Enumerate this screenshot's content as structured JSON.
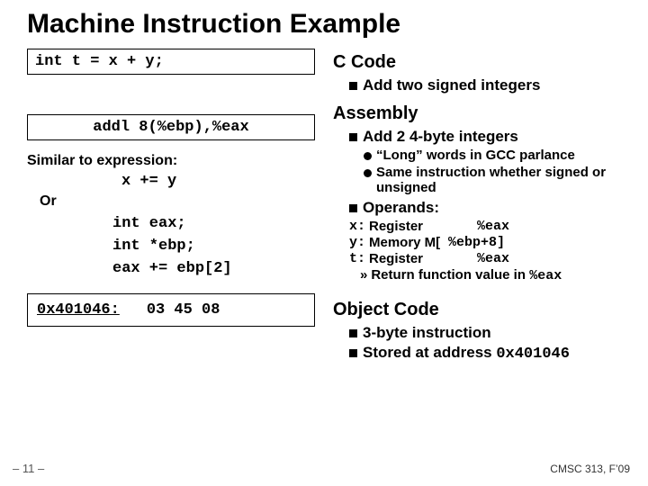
{
  "title": "Machine Instruction Example",
  "left": {
    "ccode": "int t = x + y;",
    "asm": "addl 8(%ebp),%eax",
    "similar_label": "Similar to expression:",
    "expr": "x += y",
    "or_label": "Or",
    "stmt1": "int eax;",
    "stmt2": "int *ebp;",
    "stmt3": "eax += ebp[2]",
    "obj_addr": "0x401046:",
    "obj_bytes": "03 45 08"
  },
  "right": {
    "ccode_head": "C Code",
    "ccode_b1": "Add two signed integers",
    "asm_head": "Assembly",
    "asm_b1": "Add 2 4-byte integers",
    "asm_s1": "“Long” words in GCC parlance",
    "asm_s2": "Same instruction whether signed or unsigned",
    "asm_b2": "Operands:",
    "op_x_lbl": "x:",
    "op_x_desc": "Register",
    "op_x_val": "%eax",
    "op_y_lbl": "y:",
    "op_y_desc": "Memory M[",
    "op_y_val": "%ebp+8]",
    "op_t_lbl": "t:",
    "op_t_desc": "Register",
    "op_t_val": "%eax",
    "ret_arrow": "»",
    "ret_text": "Return function value in ",
    "ret_reg": "%eax",
    "obj_head": "Object Code",
    "obj_b1": "3-byte instruction",
    "obj_b2_a": "Stored at address ",
    "obj_b2_b": "0x401046"
  },
  "pagenum": "– 11 –",
  "footer": "CMSC 313, F’09"
}
